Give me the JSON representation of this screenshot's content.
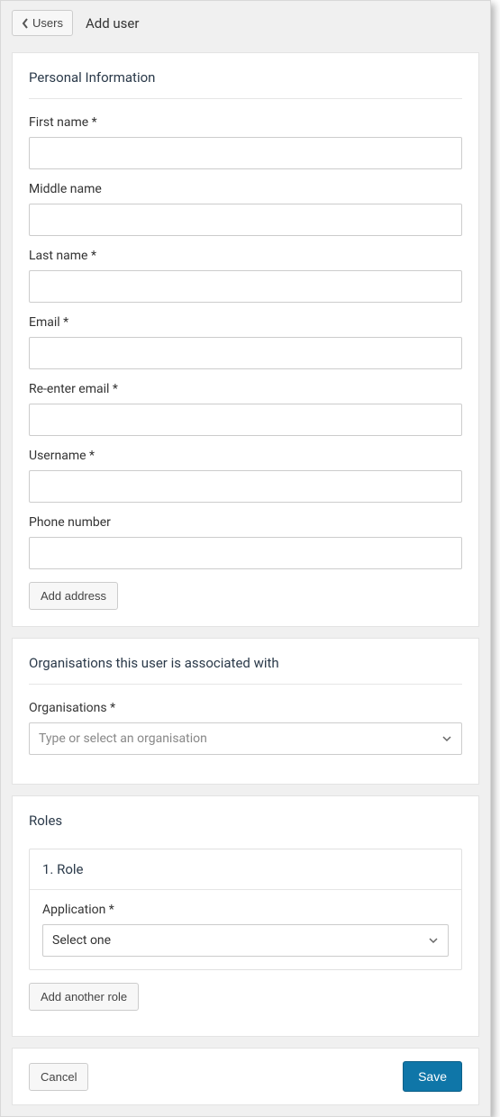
{
  "header": {
    "back_label": "Users",
    "title": "Add user"
  },
  "personal": {
    "heading": "Personal Information",
    "first_name_label": "First name *",
    "first_name_value": "",
    "middle_name_label": "Middle name",
    "middle_name_value": "",
    "last_name_label": "Last name *",
    "last_name_value": "",
    "email_label": "Email *",
    "email_value": "",
    "reenter_email_label": "Re-enter email *",
    "reenter_email_value": "",
    "username_label": "Username *",
    "username_value": "",
    "phone_label": "Phone number",
    "phone_value": "",
    "add_address_label": "Add address"
  },
  "orgs": {
    "heading": "Organisations this user is associated with",
    "label": "Organisations *",
    "placeholder": "Type or select an organisation"
  },
  "roles": {
    "heading": "Roles",
    "role_heading": "1. Role",
    "application_label": "Application *",
    "application_selected": "Select one",
    "add_role_label": "Add another role"
  },
  "footer": {
    "cancel_label": "Cancel",
    "save_label": "Save"
  }
}
